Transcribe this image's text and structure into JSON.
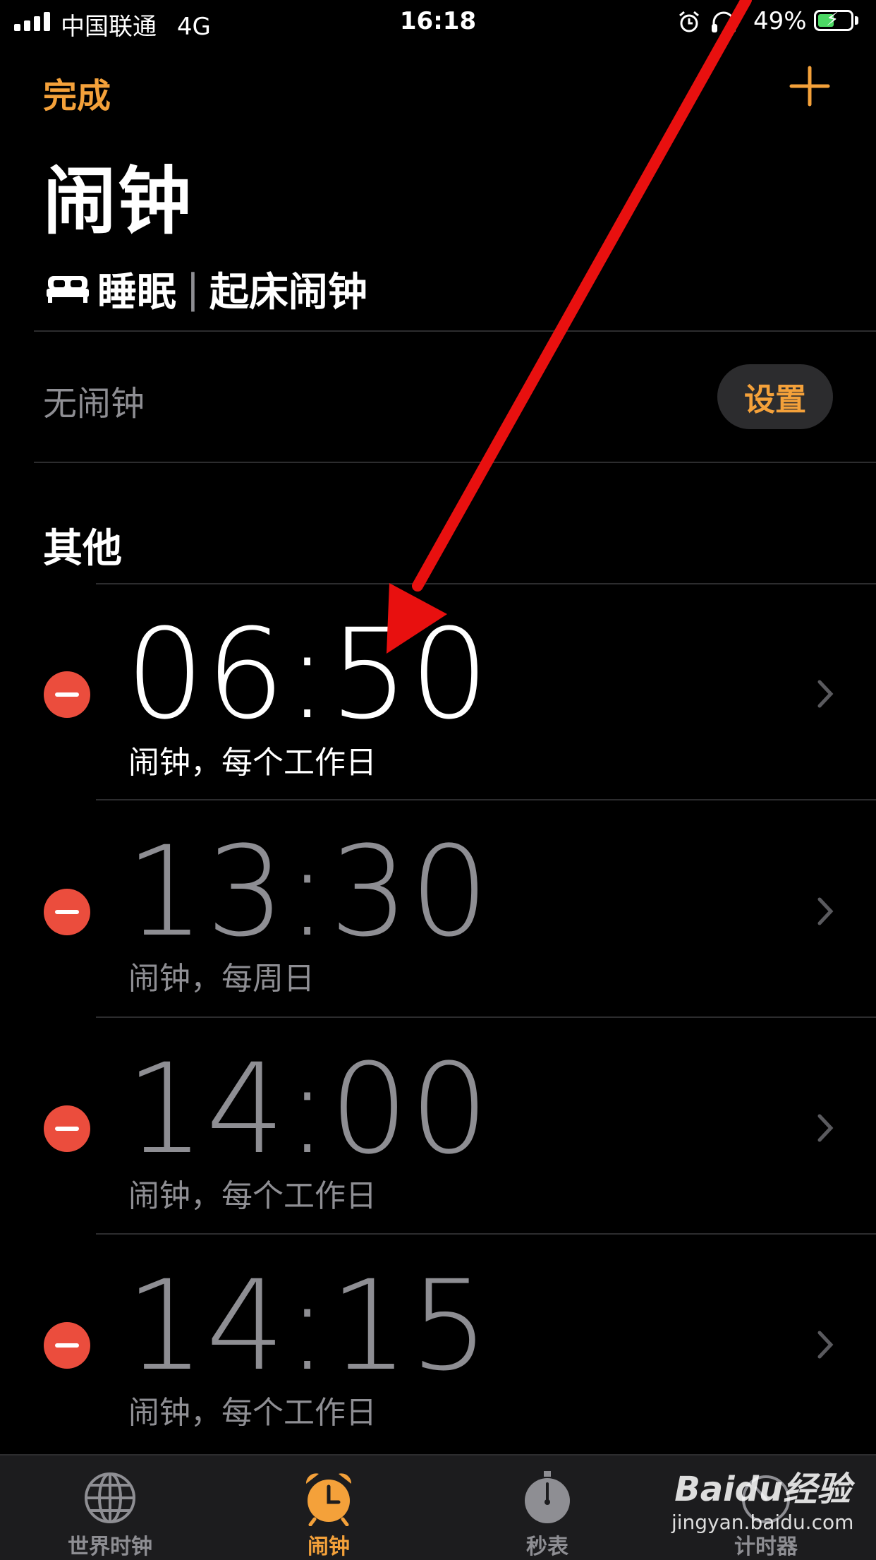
{
  "status_bar": {
    "carrier": "中国联通",
    "network": "4G",
    "time": "16:18",
    "battery_percent": "49%",
    "battery_level": 0.49
  },
  "nav": {
    "done_label": "完成",
    "add_icon": "plus-icon",
    "title": "闹钟"
  },
  "sleep": {
    "icon": "bed-icon",
    "label": "睡眠",
    "separator": "|",
    "subtitle": "起床闹钟",
    "no_alarm_text": "无闹钟",
    "set_label": "设置"
  },
  "others": {
    "heading": "其他",
    "alarms": [
      {
        "time": "06:50",
        "label": "闹钟，每个工作日",
        "enabled": true
      },
      {
        "time": "13:30",
        "label": "闹钟，每周日",
        "enabled": false
      },
      {
        "time": "14:00",
        "label": "闹钟，每个工作日",
        "enabled": false
      },
      {
        "time": "14:15",
        "label": "闹钟，每个工作日",
        "enabled": false
      }
    ]
  },
  "tabs": [
    {
      "label": "世界时钟",
      "icon": "globe-icon",
      "selected": false
    },
    {
      "label": "闹钟",
      "icon": "alarm-clock-icon",
      "selected": true
    },
    {
      "label": "秒表",
      "icon": "stopwatch-icon",
      "selected": false
    },
    {
      "label": "计时器",
      "icon": "timer-icon",
      "selected": false
    }
  ],
  "colors": {
    "accent": "#f4a13a",
    "delete": "#eb4d3d",
    "secondary_text": "#8e8e93",
    "annotation_arrow": "#e8100f"
  },
  "watermark": {
    "brand": "Baidu经验",
    "url": "jingyan.baidu.com"
  }
}
